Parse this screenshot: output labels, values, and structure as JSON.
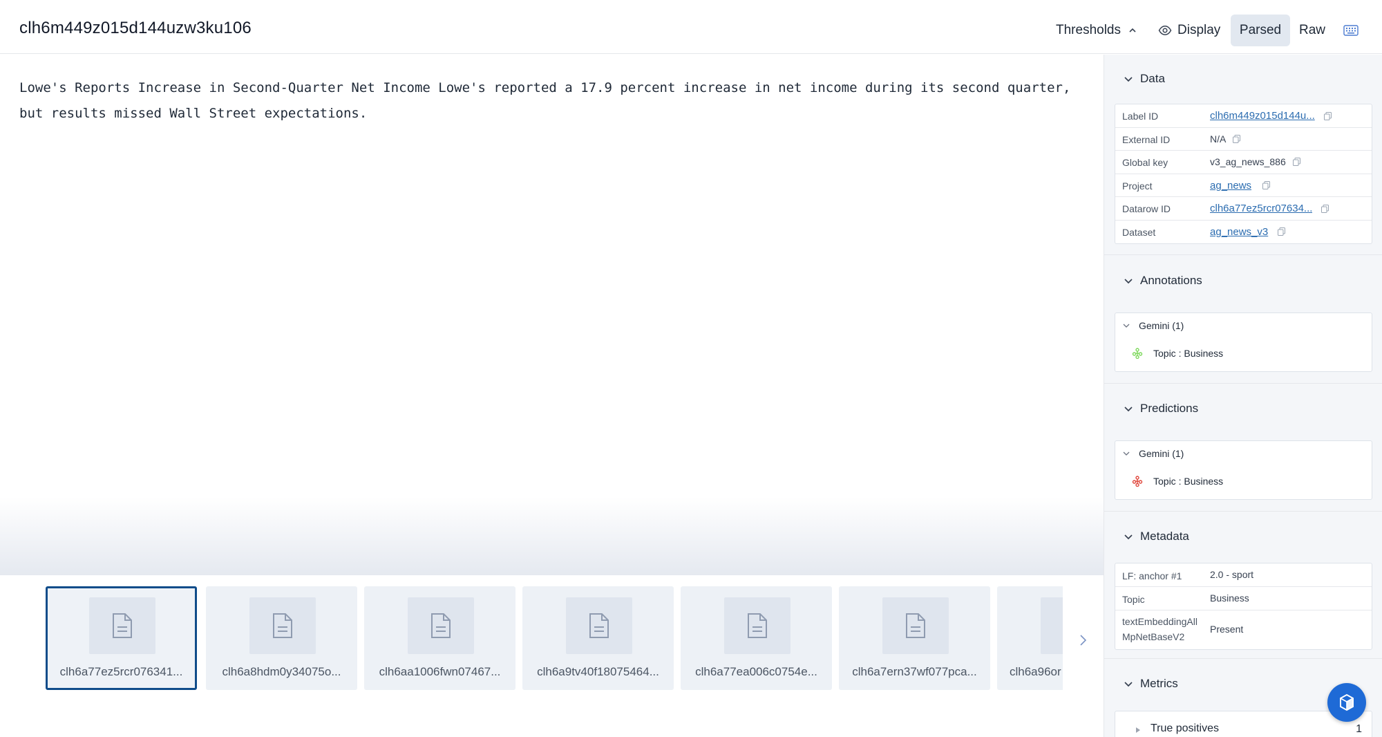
{
  "header": {
    "title": "clh6m449z015d144uzw3ku106",
    "thresholds_label": "Thresholds",
    "display_label": "Display",
    "parsed_label": "Parsed",
    "raw_label": "Raw"
  },
  "main": {
    "text": "Lowe's Reports Increase in Second-Quarter Net Income Lowe's reported a 17.9 percent increase in net income during its second quarter, but results missed Wall Street expectations."
  },
  "thumbnails": [
    {
      "label": "clh6a77ez5rcr076341...",
      "selected": true
    },
    {
      "label": "clh6a8hdm0y34075o...",
      "selected": false
    },
    {
      "label": "clh6aa1006fwn07467...",
      "selected": false
    },
    {
      "label": "clh6a9tv40f18075464...",
      "selected": false
    },
    {
      "label": "clh6a77ea006c0754e...",
      "selected": false
    },
    {
      "label": "clh6a7ern37wf077pca...",
      "selected": false
    },
    {
      "label": "clh6a96or",
      "selected": false
    }
  ],
  "sidebar": {
    "data": {
      "title": "Data",
      "rows": [
        {
          "key": "Label ID",
          "value": "clh6m449z015d144u...",
          "link": true
        },
        {
          "key": "External ID",
          "value": "N/A",
          "link": false
        },
        {
          "key": "Global key",
          "value": "v3_ag_news_886",
          "link": false
        },
        {
          "key": "Project",
          "value": "ag_news",
          "link": true
        },
        {
          "key": "Datarow ID",
          "value": "clh6a77ez5rcr07634...",
          "link": true
        },
        {
          "key": "Dataset",
          "value": "ag_news_v3",
          "link": true
        }
      ]
    },
    "annotations": {
      "title": "Annotations",
      "group": "Gemini (1)",
      "item": "Topic : Business",
      "icon_color": "#7cd85a"
    },
    "predictions": {
      "title": "Predictions",
      "group": "Gemini (1)",
      "item": "Topic : Business",
      "icon_color": "#e0453a"
    },
    "metadata": {
      "title": "Metadata",
      "rows": [
        {
          "key": "LF: anchor #1",
          "value": "2.0 - sport"
        },
        {
          "key": "Topic",
          "value": "Business"
        },
        {
          "key": "textEmbeddingAllMpNetBaseV2",
          "value": "Present"
        }
      ]
    },
    "metrics": {
      "title": "Metrics",
      "row_label": "True positives",
      "row_value": "1"
    }
  },
  "colors": {
    "accent": "#0f4c8a",
    "link": "#2b6cb0",
    "fab": "#1e6ad6"
  }
}
